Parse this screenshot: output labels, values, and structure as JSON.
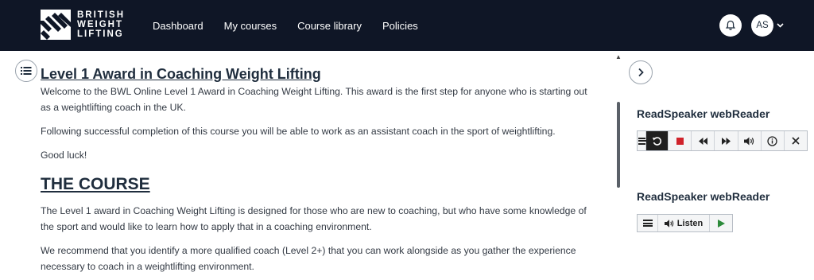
{
  "brand": {
    "line1": "BRITISH",
    "line2": "WEIGHT",
    "line3": "LIFTING",
    "colors": {
      "navbar": "#0f1626",
      "text_dark": "#1f2d3d",
      "play_green": "#2c8a3a",
      "stop_red": "#d0232b"
    }
  },
  "nav": {
    "items": [
      {
        "label": "Dashboard"
      },
      {
        "label": "My courses"
      },
      {
        "label": "Course library"
      },
      {
        "label": "Policies"
      }
    ],
    "user_initials": "AS",
    "icons": {
      "notifications": "bell-icon",
      "user_menu": "chevron-down-icon"
    }
  },
  "course": {
    "title": "Level 1 Award in Coaching Weight Lifting",
    "intro": [
      "Welcome to the BWL Online Level 1 Award in Coaching Weight Lifting. This award is the first step for anyone who is starting out as a weightlifting coach in the UK.",
      "Following successful completion of this course you will be able to work as an assistant coach in the sport of weightlifting.",
      "Good luck!"
    ],
    "section_heading": "THE COURSE",
    "section_paras": [
      "The Level 1 award in Coaching Weight Lifting is designed for those who are new to coaching, but who have some knowledge of the sport and would like to learn how to apply that in a coaching environment.",
      "We recommend that you identify a more qualified coach (Level 2+) that you can work alongside as you gather the experience necessary to coach in a weightlifting environment."
    ]
  },
  "readspeaker": {
    "title_1": "ReadSpeaker webReader",
    "title_2": "ReadSpeaker webReader",
    "listen_label": "Listen",
    "player_icons": [
      "menu-icon",
      "rewind-icon",
      "stop-icon",
      "skip-back-icon",
      "skip-forward-icon",
      "volume-icon",
      "info-icon",
      "close-icon"
    ]
  }
}
